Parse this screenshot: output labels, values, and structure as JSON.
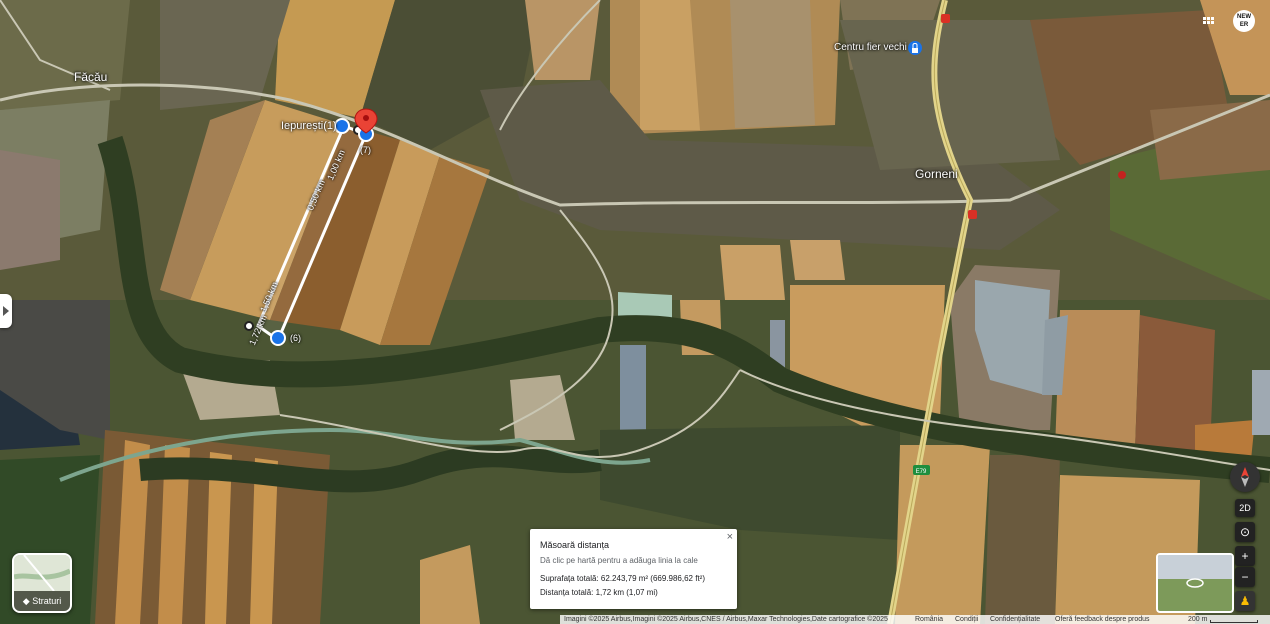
{
  "places": {
    "facau": "Făcău",
    "iepuresti": "Iepurești(1)",
    "gorneni": "Gorneni",
    "centru_fier": "Centru fier vechi",
    "road_ref": "E79"
  },
  "measure_labels": {
    "route_count": "(7)",
    "end_count": "(6)",
    "lbl_050": "0,50 km",
    "lbl_100": "1,00 km",
    "lbl_150": "1,50 km",
    "lbl_172": "1,72 km"
  },
  "measure_panel": {
    "title": "Măsoară distanța",
    "hint": "Dă clic pe hartă pentru a adăuga linia la cale",
    "area": "Suprafața totală: 62.243,79 m² (669.986,62 ft²)",
    "distance": "Distanța totală: 1,72 km (1,07 mi)",
    "close": "×"
  },
  "layers_button": {
    "label": "Straturi"
  },
  "controls": {
    "view_2d": "2D",
    "zoom_in": "+",
    "zoom_out": "−",
    "location_icon": "locate-icon",
    "compass_icon": "compass-icon",
    "pegman_icon": "pegman-icon"
  },
  "logo": {
    "line1": "NEW",
    "line2": "ER"
  },
  "footer": {
    "imagery": "Imagini ©2025 Airbus,Imagini ©2025 Airbus,CNES / Airbus,Maxar Technologies,Date cartografice ©2025",
    "romania": "România",
    "terms": "Condiții",
    "privacy": "Confidențialitate",
    "feedback": "Oferă feedback despre produs",
    "scale": "200 m"
  },
  "colors": {
    "road": "#e2d48a",
    "measure_line": "#ffffff",
    "marker_blue": "#1a73e8",
    "pin_red": "#ea4335"
  }
}
